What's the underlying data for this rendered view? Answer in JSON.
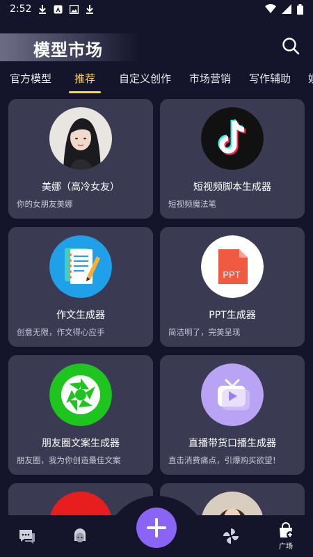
{
  "status_bar": {
    "time": "2:52"
  },
  "header": {
    "title": "模型市场"
  },
  "tabs": [
    {
      "label": "官方模型"
    },
    {
      "label": "推荐"
    },
    {
      "label": "自定义创作"
    },
    {
      "label": "市场营销"
    },
    {
      "label": "写作辅助"
    },
    {
      "label": "娱"
    }
  ],
  "cards": [
    {
      "title": "美娜（高冷女友）",
      "desc": "你的女朋友美娜",
      "icon": "portrait-girl-icon"
    },
    {
      "title": "短视频脚本生成器",
      "desc": "短视频魔法笔",
      "icon": "tiktok-logo-icon"
    },
    {
      "title": "作文生成器",
      "desc": "创意无限，作文得心应手",
      "icon": "notebook-pencil-icon"
    },
    {
      "title": "PPT生成器",
      "desc": "简洁明了，完美呈现",
      "icon": "ppt-file-icon",
      "badge": "PPT"
    },
    {
      "title": "朋友圈文案生成器",
      "desc": "朋友圈，我为你创造最佳文案",
      "icon": "camera-aperture-icon"
    },
    {
      "title": "直播带货口播生成器",
      "desc": "直击消费痛点，引爆购买欲望！",
      "icon": "tv-play-icon"
    }
  ],
  "bottom_nav": {
    "items": [
      {
        "icon": "chat-icon"
      },
      {
        "icon": "character-icon"
      },
      {
        "icon": "pinwheel-icon"
      },
      {
        "icon": "plaza-icon",
        "label": "广场"
      }
    ]
  },
  "colors": {
    "accent": "#ffd34d",
    "fab": "#8a64f4",
    "card": "#3a3a52",
    "background": "#14142a"
  }
}
